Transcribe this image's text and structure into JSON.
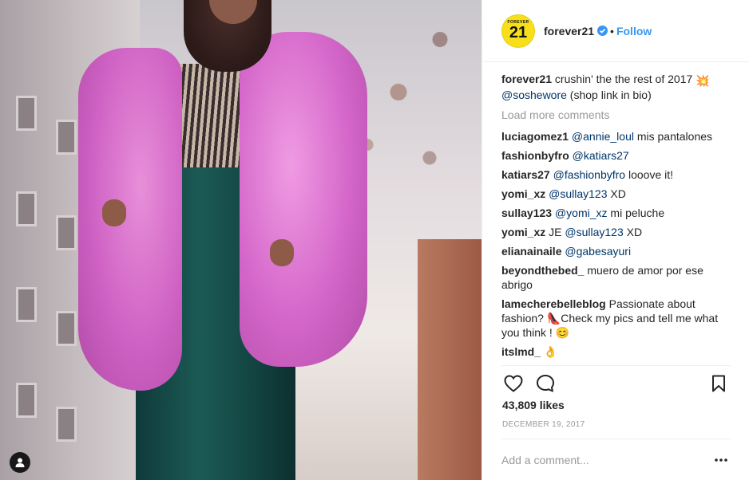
{
  "post": {
    "username": "forever21",
    "follow_label": "Follow",
    "separator": "•",
    "avatar_text_small": "FOREVER",
    "avatar_text_big": "21",
    "caption": {
      "user": "forever21",
      "text": " crushin' the the rest of 2017 ",
      "emoji": "💥",
      "mention": "@soshewore",
      "tail": " (shop link in bio)"
    },
    "load_more_label": "Load more comments",
    "comments": [
      {
        "user": "luciagomez1",
        "mention": "@annie_loul",
        "text": " mis pantalones"
      },
      {
        "user": "fashionbyfro",
        "mention": "@katiars27",
        "text": ""
      },
      {
        "user": "katiars27",
        "mention": "@fashionbyfro",
        "text": " looove it!"
      },
      {
        "user": "yomi_xz",
        "mention": "@sullay123",
        "text": " XD"
      },
      {
        "user": "sullay123",
        "mention": "@yomi_xz",
        "text": " mi peluche"
      },
      {
        "user": "yomi_xz",
        "prefix": " JE ",
        "mention": "@sullay123",
        "text": " XD"
      },
      {
        "user": "elianainaile",
        "mention": "@gabesayuri",
        "text": ""
      },
      {
        "user": "beyondthebed_",
        "mention": "",
        "text": " muero de amor por ese abrigo"
      },
      {
        "user": "lamecherebelleblog",
        "mention": "",
        "text": " Passionate about fashion? 👠Check my pics and tell me what you think ! 😊"
      },
      {
        "user": "itslmd_",
        "mention": "",
        "text": " 👌"
      }
    ],
    "likes": "43,809 likes",
    "date": "DECEMBER 19, 2017",
    "add_comment_placeholder": "Add a comment...",
    "more_label": "•••"
  },
  "icons": {
    "like": "heart-icon",
    "comment": "comment-bubble-icon",
    "save": "bookmark-icon",
    "verified": "verified-badge-icon",
    "user_tag": "user-tag-icon"
  },
  "colors": {
    "link_blue": "#3897f0",
    "mention_blue": "#003569",
    "muted": "#999999",
    "avatar_yellow": "#f7e01b"
  }
}
